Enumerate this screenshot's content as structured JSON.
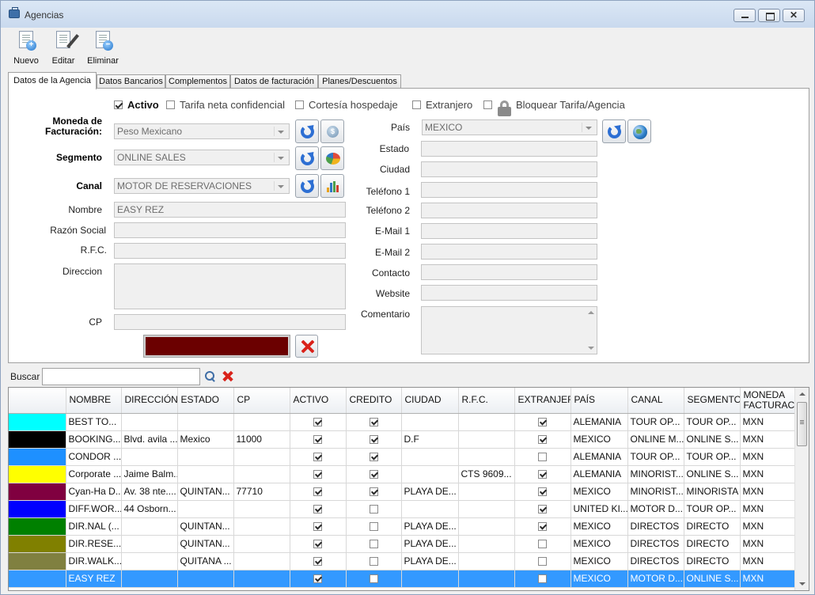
{
  "window": {
    "title": "Agencias"
  },
  "toolbar": {
    "new_label": "Nuevo",
    "edit_label": "Editar",
    "delete_label": "Eliminar"
  },
  "tabs": [
    "Datos de la Agencia",
    "Datos Bancarios",
    "Complementos",
    "Datos de facturación",
    "Planes/Descuentos"
  ],
  "options": {
    "activo": {
      "label": "Activo",
      "checked": true
    },
    "tarifa": {
      "label": "Tarifa neta confidencial",
      "checked": false
    },
    "cortesia": {
      "label": "Cortesía hospedaje",
      "checked": false
    },
    "extranjero": {
      "label": "Extranjero",
      "checked": false
    },
    "bloquear": {
      "label": "Bloquear Tarifa/Agencia",
      "checked": false
    }
  },
  "left_form": {
    "moneda_label": "Moneda de\nFacturación:",
    "moneda_value": "Peso Mexicano",
    "segmento_label": "Segmento",
    "segmento_value": "ONLINE SALES",
    "canal_label": "Canal",
    "canal_value": "MOTOR DE RESERVACIONES",
    "nombre_label": "Nombre",
    "nombre_value": "EASY REZ",
    "razon_label": "Razón Social",
    "razon_value": "",
    "rfc_label": "R.F.C.",
    "rfc_value": "",
    "direccion_label": "Direccion",
    "direccion_value": "",
    "cp_label": "CP",
    "cp_value": "",
    "color_value": "#6b0000"
  },
  "right_form": {
    "pais_label": "País",
    "pais_value": "MEXICO",
    "estado_label": "Estado",
    "estado_value": "",
    "ciudad_label": "Ciudad",
    "ciudad_value": "",
    "tel1_label": "Teléfono 1",
    "tel1_value": "",
    "tel2_label": "Teléfono 2",
    "tel2_value": "",
    "email1_label": "E-Mail 1",
    "email1_value": "",
    "email2_label": "E-Mail 2",
    "email2_value": "",
    "contacto_label": "Contacto",
    "contacto_value": "",
    "website_label": "Website",
    "website_value": "",
    "comentario_label": "Comentario",
    "comentario_value": ""
  },
  "search": {
    "label": "Buscar",
    "value": ""
  },
  "grid": {
    "columns": [
      "",
      "NOMBRE",
      "DIRECCIÓN",
      "ESTADO",
      "CP",
      "ACTIVO",
      "CREDITO",
      "CIUDAD",
      "R.F.C.",
      "EXTRANJERO",
      "PAÍS",
      "CANAL",
      "SEGMENTO",
      "MONEDA FACTURACION"
    ],
    "rows": [
      {
        "color": "#00ffff",
        "nombre": "BEST TO...",
        "direccion": "",
        "estado": "",
        "cp": "",
        "activo": true,
        "credito": true,
        "ciudad": "",
        "rfc": "",
        "extranjero": true,
        "pais": "ALEMANIA",
        "canal": "TOUR OP...",
        "segmento": "TOUR OP...",
        "moneda": "MXN"
      },
      {
        "color": "#000000",
        "nombre": "BOOKING....",
        "direccion": "Blvd. avila ...",
        "estado": "Mexico",
        "cp": "11000",
        "activo": true,
        "credito": true,
        "ciudad": "D.F",
        "rfc": "",
        "extranjero": true,
        "pais": "MEXICO",
        "canal": "ONLINE M...",
        "segmento": "ONLINE S...",
        "moneda": "MXN"
      },
      {
        "color": "#1e90ff",
        "nombre": "CONDOR ...",
        "direccion": "",
        "estado": "",
        "cp": "",
        "activo": true,
        "credito": true,
        "ciudad": "",
        "rfc": "",
        "extranjero": false,
        "pais": "ALEMANIA",
        "canal": "TOUR OP...",
        "segmento": "TOUR OP...",
        "moneda": "MXN"
      },
      {
        "color": "#ffff00",
        "nombre": "Corporate ...",
        "direccion": "Jaime Balm...",
        "estado": "",
        "cp": "",
        "activo": true,
        "credito": true,
        "ciudad": "",
        "rfc": "CTS 9609...",
        "extranjero": true,
        "pais": "ALEMANIA",
        "canal": "MINORIST...",
        "segmento": "ONLINE S...",
        "moneda": "MXN"
      },
      {
        "color": "#800040",
        "nombre": "Cyan-Ha D...",
        "direccion": "Av. 38 nte....",
        "estado": "QUINTAN...",
        "cp": "77710",
        "activo": true,
        "credito": true,
        "ciudad": "PLAYA DE...",
        "rfc": "",
        "extranjero": true,
        "pais": "MEXICO",
        "canal": "MINORIST...",
        "segmento": "MINORISTA",
        "moneda": "MXN"
      },
      {
        "color": "#0000ff",
        "nombre": "DIFF.WOR...",
        "direccion": "44 Osborn...",
        "estado": "",
        "cp": "",
        "activo": true,
        "credito": false,
        "ciudad": "",
        "rfc": "",
        "extranjero": true,
        "pais": "UNITED KI...",
        "canal": "MOTOR D...",
        "segmento": "TOUR OP...",
        "moneda": "MXN"
      },
      {
        "color": "#008000",
        "nombre": "DIR.NAL (...",
        "direccion": "",
        "estado": "QUINTAN...",
        "cp": "",
        "activo": true,
        "credito": false,
        "ciudad": "PLAYA DE...",
        "rfc": "",
        "extranjero": true,
        "pais": "MEXICO",
        "canal": "DIRECTOS",
        "segmento": "DIRECTO",
        "moneda": "MXN"
      },
      {
        "color": "#808000",
        "nombre": "DIR.RESE...",
        "direccion": "",
        "estado": "QUINTAN...",
        "cp": "",
        "activo": true,
        "credito": false,
        "ciudad": "PLAYA DE...",
        "rfc": "",
        "extranjero": false,
        "pais": "MEXICO",
        "canal": "DIRECTOS",
        "segmento": "DIRECTO",
        "moneda": "MXN"
      },
      {
        "color": "#808040",
        "nombre": "DIR.WALK...",
        "direccion": "",
        "estado": "QUITANA ...",
        "cp": "",
        "activo": true,
        "credito": false,
        "ciudad": "PLAYA DE...",
        "rfc": "",
        "extranjero": false,
        "pais": "MEXICO",
        "canal": "DIRECTOS",
        "segmento": "DIRECTO",
        "moneda": "MXN"
      },
      {
        "color": "#3399ff",
        "nombre": "EASY REZ",
        "direccion": "",
        "estado": "",
        "cp": "",
        "activo": true,
        "credito": false,
        "ciudad": "",
        "rfc": "",
        "extranjero": false,
        "pais": "MEXICO",
        "canal": "MOTOR D...",
        "segmento": "ONLINE S...",
        "moneda": "MXN",
        "selected": true
      }
    ]
  }
}
